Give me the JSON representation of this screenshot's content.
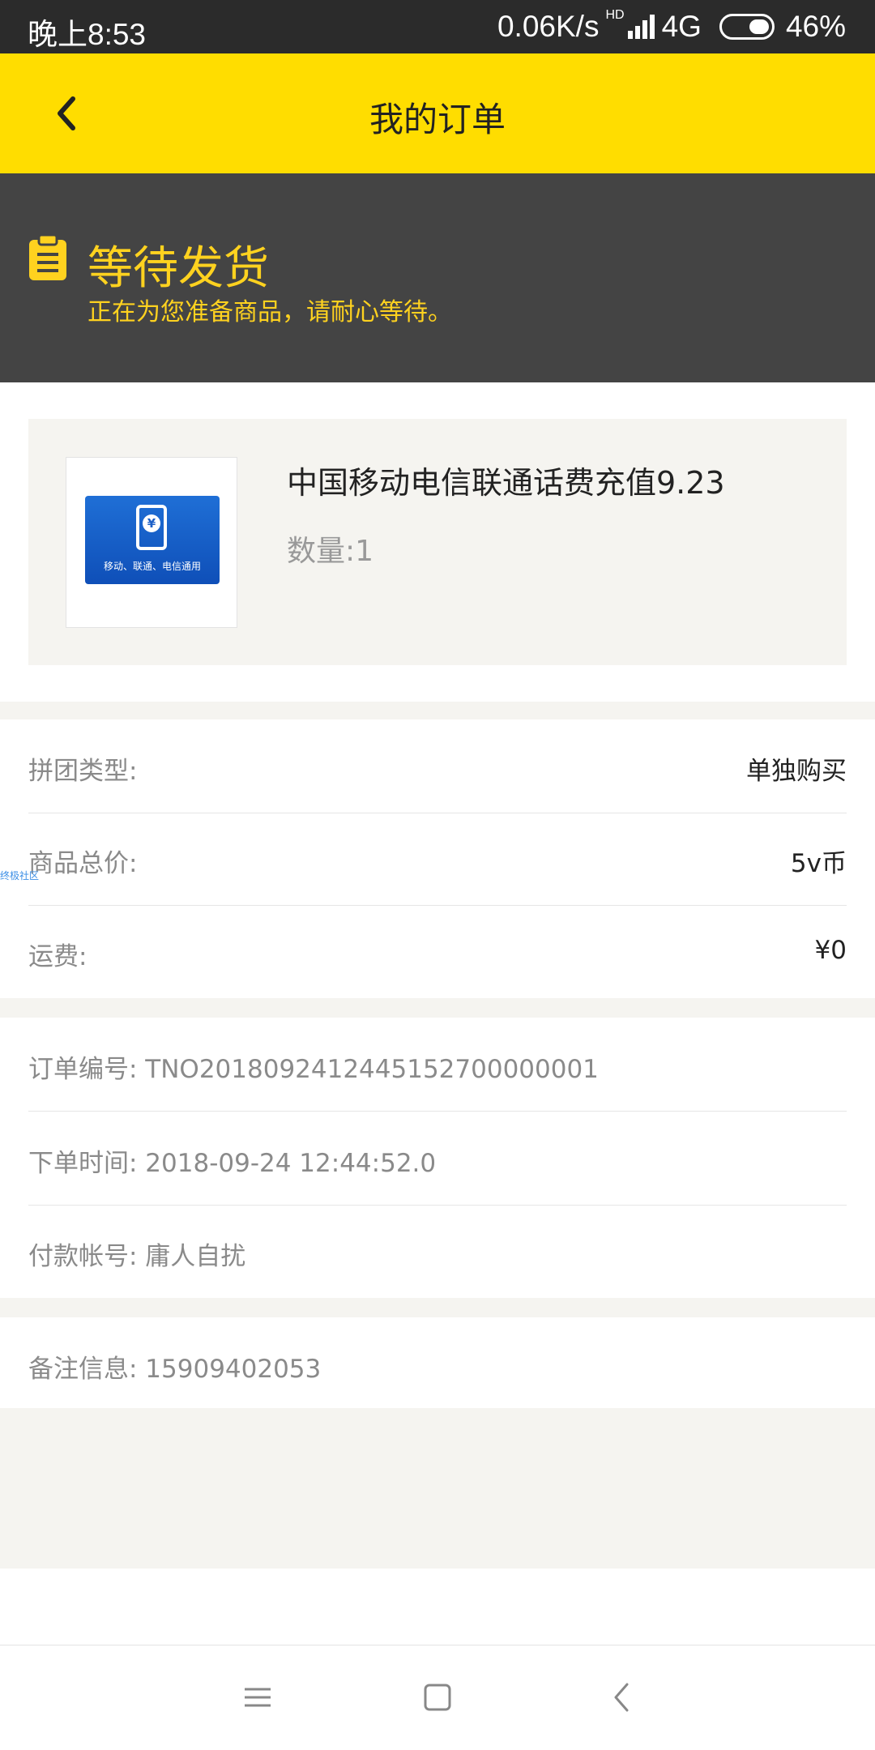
{
  "status_bar": {
    "time": "晚上8:53",
    "network_speed": "0.06K/s",
    "hd": "HD",
    "network_type": "4G",
    "battery": "46%"
  },
  "app_bar": {
    "title": "我的订单",
    "back_icon": "chevron-left-icon"
  },
  "order_status": {
    "icon": "clipboard-icon",
    "title": "等待发货",
    "subtitle": "正在为您准备商品，请耐心等待。",
    "color": "#ffd21f"
  },
  "product": {
    "name": "中国移动电信联通话费充值9.23",
    "quantity": "数量:1",
    "thumb_label": "移动、联通、电信通用",
    "thumb_symbol": "¥"
  },
  "pricing": [
    {
      "label": "拼团类型:",
      "value": "单独购买"
    },
    {
      "label": "商品总价:",
      "value": "5v币"
    },
    {
      "label": "运费:",
      "value": "¥0"
    }
  ],
  "order_info": [
    {
      "text": "订单编号: TNO2018092412445152700000001"
    },
    {
      "text": "下单时间: 2018-09-24 12:44:52.0"
    },
    {
      "text": "付款帐号: 庸人自扰"
    }
  ],
  "remark": {
    "text": "备注信息: 15909402053"
  },
  "watermark": "终极社区",
  "colors": {
    "app_bar": "#ffdd00",
    "banner": "#444444",
    "accent": "#ffd21f"
  }
}
